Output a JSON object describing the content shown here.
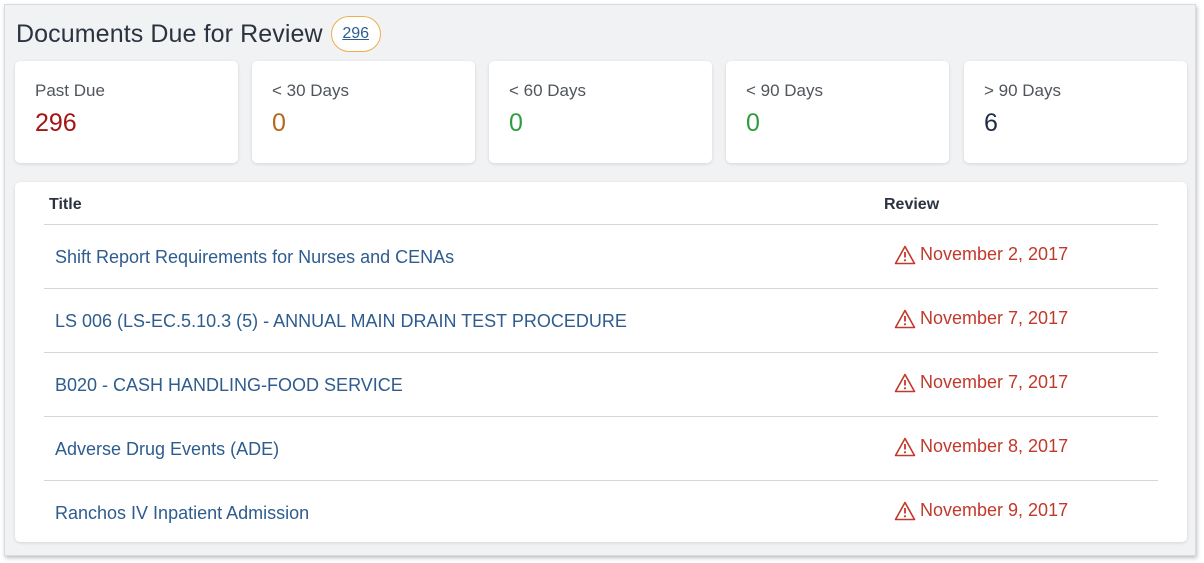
{
  "header": {
    "title": "Documents Due for Review",
    "count": "296"
  },
  "cards": [
    {
      "label": "Past Due",
      "value": "296",
      "color": "#a31515"
    },
    {
      "label": "< 30 Days",
      "value": "0",
      "color": "#b5681c"
    },
    {
      "label": "< 60 Days",
      "value": "0",
      "color": "#2f9e3f"
    },
    {
      "label": "< 90 Days",
      "value": "0",
      "color": "#2f9e3f"
    },
    {
      "label": "> 90 Days",
      "value": "6",
      "color": "#1f2d44"
    }
  ],
  "table": {
    "columns": {
      "title": "Title",
      "review": "Review"
    },
    "rows": [
      {
        "title": "Shift Report Requirements for Nurses and CENAs",
        "review": "November 2, 2017",
        "icon": "warning-icon"
      },
      {
        "title": "LS 006 (LS-EC.5.10.3 (5) - ANNUAL MAIN DRAIN TEST PROCEDURE",
        "review": "November 7, 2017",
        "icon": "warning-icon"
      },
      {
        "title": "B020 - CASH HANDLING-FOOD SERVICE",
        "review": "November 7, 2017",
        "icon": "warning-icon"
      },
      {
        "title": "Adverse Drug Events (ADE)",
        "review": "November 8, 2017",
        "icon": "warning-icon"
      },
      {
        "title": "Ranchos IV Inpatient Admission",
        "review": "November 9, 2017",
        "icon": "warning-icon"
      }
    ]
  },
  "colors": {
    "link": "#2e5c8f",
    "warning": "#c0392b",
    "badge_border": "#f0ad4e"
  }
}
